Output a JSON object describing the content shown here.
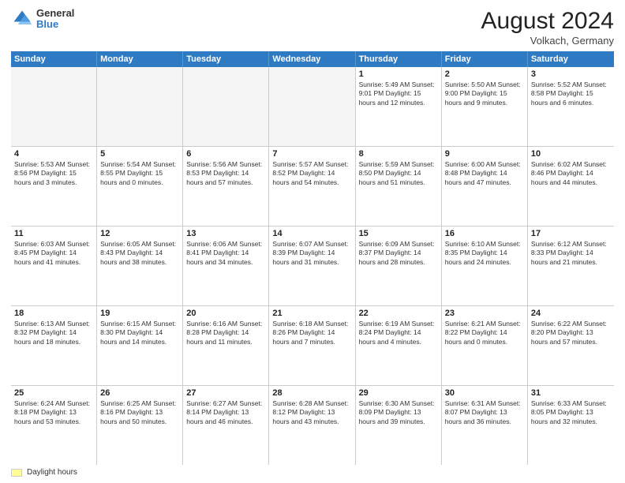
{
  "header": {
    "logo_general": "General",
    "logo_blue": "Blue",
    "month_title": "August 2024",
    "location": "Volkach, Germany"
  },
  "weekdays": [
    "Sunday",
    "Monday",
    "Tuesday",
    "Wednesday",
    "Thursday",
    "Friday",
    "Saturday"
  ],
  "footer": {
    "legend_label": "Daylight hours"
  },
  "rows": [
    [
      {
        "day": "",
        "info": ""
      },
      {
        "day": "",
        "info": ""
      },
      {
        "day": "",
        "info": ""
      },
      {
        "day": "",
        "info": ""
      },
      {
        "day": "1",
        "info": "Sunrise: 5:49 AM\nSunset: 9:01 PM\nDaylight: 15 hours\nand 12 minutes."
      },
      {
        "day": "2",
        "info": "Sunrise: 5:50 AM\nSunset: 9:00 PM\nDaylight: 15 hours\nand 9 minutes."
      },
      {
        "day": "3",
        "info": "Sunrise: 5:52 AM\nSunset: 8:58 PM\nDaylight: 15 hours\nand 6 minutes."
      }
    ],
    [
      {
        "day": "4",
        "info": "Sunrise: 5:53 AM\nSunset: 8:56 PM\nDaylight: 15 hours\nand 3 minutes."
      },
      {
        "day": "5",
        "info": "Sunrise: 5:54 AM\nSunset: 8:55 PM\nDaylight: 15 hours\nand 0 minutes."
      },
      {
        "day": "6",
        "info": "Sunrise: 5:56 AM\nSunset: 8:53 PM\nDaylight: 14 hours\nand 57 minutes."
      },
      {
        "day": "7",
        "info": "Sunrise: 5:57 AM\nSunset: 8:52 PM\nDaylight: 14 hours\nand 54 minutes."
      },
      {
        "day": "8",
        "info": "Sunrise: 5:59 AM\nSunset: 8:50 PM\nDaylight: 14 hours\nand 51 minutes."
      },
      {
        "day": "9",
        "info": "Sunrise: 6:00 AM\nSunset: 8:48 PM\nDaylight: 14 hours\nand 47 minutes."
      },
      {
        "day": "10",
        "info": "Sunrise: 6:02 AM\nSunset: 8:46 PM\nDaylight: 14 hours\nand 44 minutes."
      }
    ],
    [
      {
        "day": "11",
        "info": "Sunrise: 6:03 AM\nSunset: 8:45 PM\nDaylight: 14 hours\nand 41 minutes."
      },
      {
        "day": "12",
        "info": "Sunrise: 6:05 AM\nSunset: 8:43 PM\nDaylight: 14 hours\nand 38 minutes."
      },
      {
        "day": "13",
        "info": "Sunrise: 6:06 AM\nSunset: 8:41 PM\nDaylight: 14 hours\nand 34 minutes."
      },
      {
        "day": "14",
        "info": "Sunrise: 6:07 AM\nSunset: 8:39 PM\nDaylight: 14 hours\nand 31 minutes."
      },
      {
        "day": "15",
        "info": "Sunrise: 6:09 AM\nSunset: 8:37 PM\nDaylight: 14 hours\nand 28 minutes."
      },
      {
        "day": "16",
        "info": "Sunrise: 6:10 AM\nSunset: 8:35 PM\nDaylight: 14 hours\nand 24 minutes."
      },
      {
        "day": "17",
        "info": "Sunrise: 6:12 AM\nSunset: 8:33 PM\nDaylight: 14 hours\nand 21 minutes."
      }
    ],
    [
      {
        "day": "18",
        "info": "Sunrise: 6:13 AM\nSunset: 8:32 PM\nDaylight: 14 hours\nand 18 minutes."
      },
      {
        "day": "19",
        "info": "Sunrise: 6:15 AM\nSunset: 8:30 PM\nDaylight: 14 hours\nand 14 minutes."
      },
      {
        "day": "20",
        "info": "Sunrise: 6:16 AM\nSunset: 8:28 PM\nDaylight: 14 hours\nand 11 minutes."
      },
      {
        "day": "21",
        "info": "Sunrise: 6:18 AM\nSunset: 8:26 PM\nDaylight: 14 hours\nand 7 minutes."
      },
      {
        "day": "22",
        "info": "Sunrise: 6:19 AM\nSunset: 8:24 PM\nDaylight: 14 hours\nand 4 minutes."
      },
      {
        "day": "23",
        "info": "Sunrise: 6:21 AM\nSunset: 8:22 PM\nDaylight: 14 hours\nand 0 minutes."
      },
      {
        "day": "24",
        "info": "Sunrise: 6:22 AM\nSunset: 8:20 PM\nDaylight: 13 hours\nand 57 minutes."
      }
    ],
    [
      {
        "day": "25",
        "info": "Sunrise: 6:24 AM\nSunset: 8:18 PM\nDaylight: 13 hours\nand 53 minutes."
      },
      {
        "day": "26",
        "info": "Sunrise: 6:25 AM\nSunset: 8:16 PM\nDaylight: 13 hours\nand 50 minutes."
      },
      {
        "day": "27",
        "info": "Sunrise: 6:27 AM\nSunset: 8:14 PM\nDaylight: 13 hours\nand 46 minutes."
      },
      {
        "day": "28",
        "info": "Sunrise: 6:28 AM\nSunset: 8:12 PM\nDaylight: 13 hours\nand 43 minutes."
      },
      {
        "day": "29",
        "info": "Sunrise: 6:30 AM\nSunset: 8:09 PM\nDaylight: 13 hours\nand 39 minutes."
      },
      {
        "day": "30",
        "info": "Sunrise: 6:31 AM\nSunset: 8:07 PM\nDaylight: 13 hours\nand 36 minutes."
      },
      {
        "day": "31",
        "info": "Sunrise: 6:33 AM\nSunset: 8:05 PM\nDaylight: 13 hours\nand 32 minutes."
      }
    ]
  ]
}
